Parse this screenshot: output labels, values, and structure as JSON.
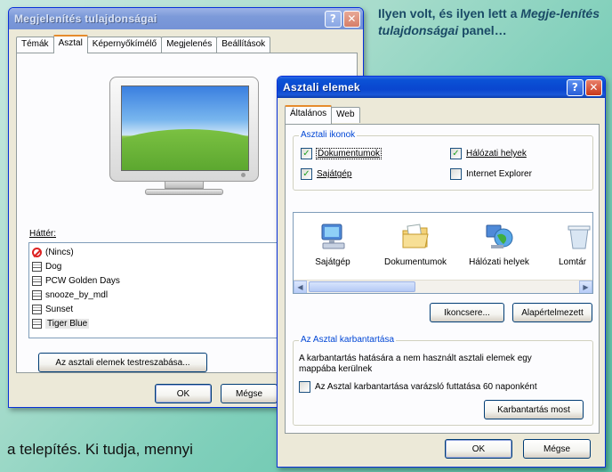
{
  "caption": {
    "line_plain": "Ilyen volt, és ilyen lett a",
    "line_italic": "Megje-lenítés tulajdonságai",
    "line_end": "panel…"
  },
  "body_text": "a telepítés. Ki tudja, mennyi",
  "display_props": {
    "title": "Megjelenítés tulajdonságai",
    "help_glyph": "?",
    "close_glyph": "✕",
    "tabs": [
      "Témák",
      "Asztal",
      "Képernyőkímélő",
      "Megjelenés",
      "Beállítások"
    ],
    "active_tab": "Asztal",
    "background_label": "Háttér:",
    "background_items": [
      "(Nincs)",
      "Dog",
      "PCW Golden Days",
      "snooze_by_mdl",
      "Sunset",
      "Tiger Blue"
    ],
    "selected_background": "Tiger Blue",
    "customize_button": "Az asztali elemek testreszabása...",
    "ok_button": "OK",
    "cancel_button": "Mégse"
  },
  "desktop_items": {
    "title": "Asztali elemek",
    "help_glyph": "?",
    "close_glyph": "✕",
    "tabs": [
      "Általános",
      "Web"
    ],
    "active_tab": "Általános",
    "icons_group_title": "Asztali ikonok",
    "checkboxes": [
      {
        "label": "Dokumentumok",
        "checked": true
      },
      {
        "label": "Hálózati helyek",
        "checked": true
      },
      {
        "label": "Sajátgép",
        "checked": true
      },
      {
        "label": "Internet Explorer",
        "checked": false
      }
    ],
    "check_glyph": "✓",
    "icon_items": [
      "Sajátgép",
      "Dokumentumok",
      "Hálózati helyek",
      "Lomtár"
    ],
    "scroll_left": "◀",
    "scroll_right": "▶",
    "change_icon_button": "Ikoncsere...",
    "restore_default_button": "Alapértelmezett",
    "cleanup_group_title": "Az Asztal karbantartása",
    "cleanup_text": "A karbantartás hatására a nem használt asztali elemek egy mappába kerülnek",
    "cleanup_checkbox": {
      "label": "Az Asztal karbantartása varázsló futtatása 60 naponként",
      "checked": false
    },
    "cleanup_now_button": "Karbantartás most",
    "ok_button": "OK",
    "cancel_button": "Mégse"
  },
  "colors": {
    "titlebar_active": "#0a46cf",
    "titlebar_inactive": "#7c9ad9",
    "dialog_face": "#ece9d8",
    "active_tab_accent": "#e68b2c",
    "group_title": "#0046d5",
    "caption_text": "#1a4a66"
  }
}
